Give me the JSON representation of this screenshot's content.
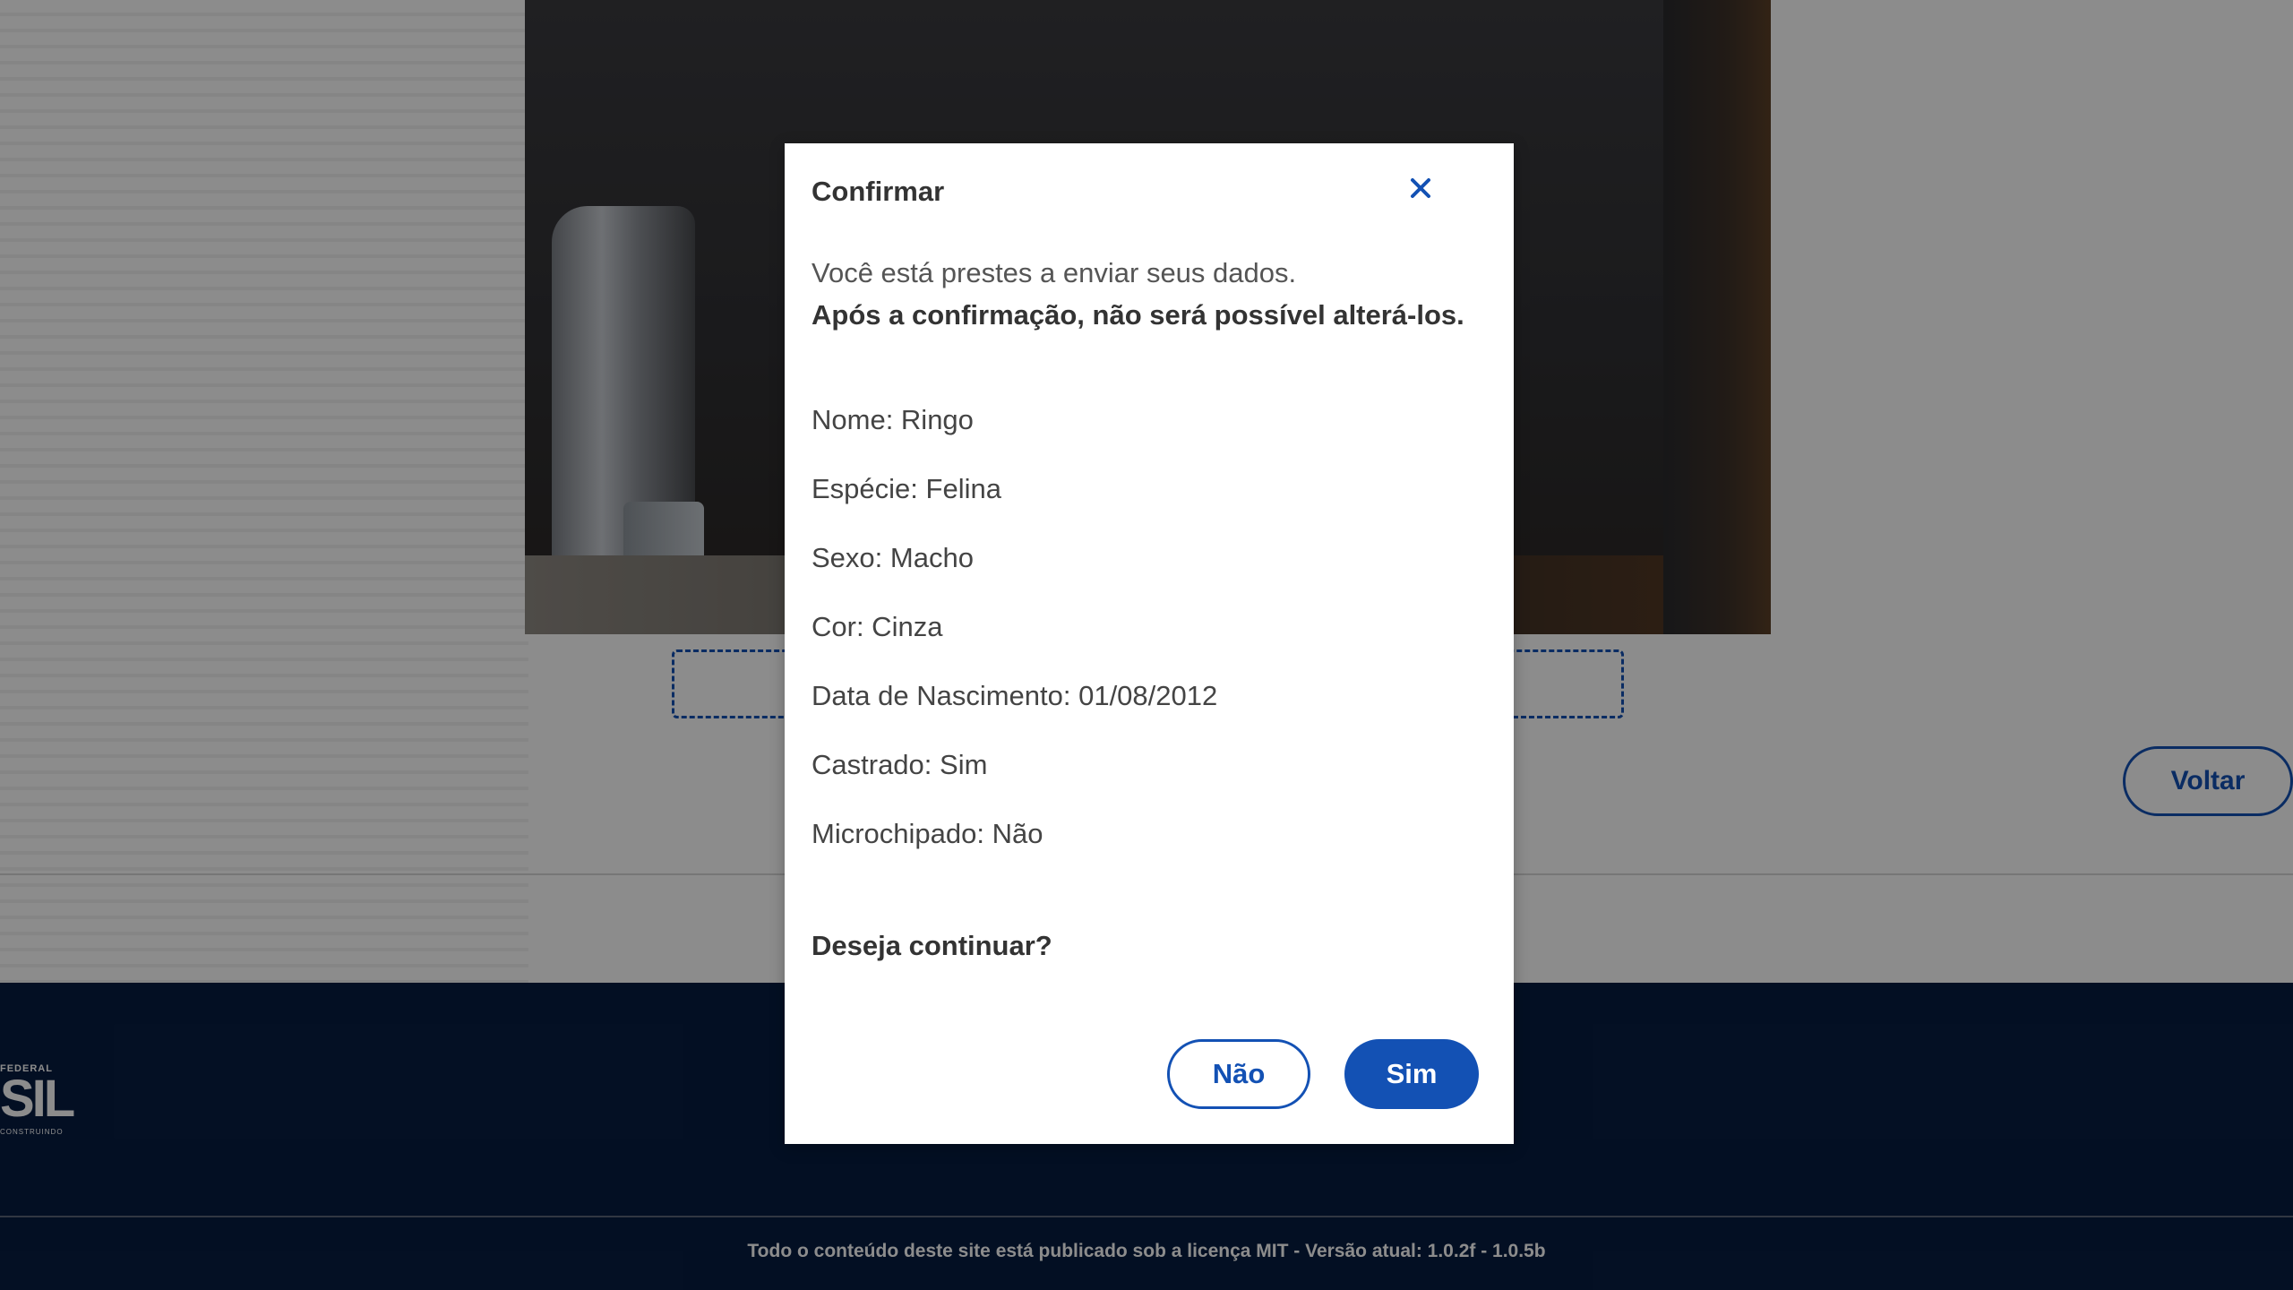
{
  "background": {
    "back_button": "Voltar",
    "footer": {
      "logo_top": "FEDERAL",
      "logo_main": "SIL",
      "logo_bottom": "CONSTRUINDO",
      "license": "Todo o conteúdo deste site está publicado sob a licença MIT - Versão atual: 1.0.2f - 1.0.5b"
    }
  },
  "modal": {
    "title": "Confirmar",
    "close_icon": "close-icon",
    "intro": "Você está prestes a enviar seus dados.",
    "warning": "Após a confirmação, não será possível alterá-los.",
    "details": [
      "Nome: Ringo",
      "Espécie: Felina",
      "Sexo: Macho",
      "Cor: Cinza",
      "Data de Nascimento: 01/08/2012",
      "Castrado: Sim",
      "Microchipado: Não"
    ],
    "question": "Deseja continuar?",
    "buttons": {
      "no": "Não",
      "yes": "Sim"
    }
  },
  "colors": {
    "primary": "#1351b4",
    "footer_bg": "#071d41"
  }
}
